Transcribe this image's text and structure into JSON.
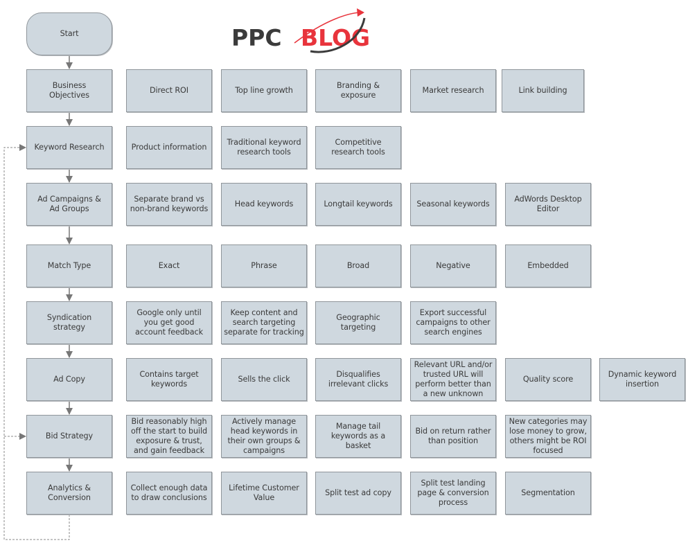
{
  "logo": {
    "text_dark": "PPC",
    "text_red": "BLOG",
    "colors": {
      "dark": "#3b3b3b",
      "red": "#e8343c"
    }
  },
  "colors": {
    "box_fill": "#cfd8df",
    "box_border": "#8f959a",
    "connector": "#777777"
  },
  "start": {
    "label": "Start"
  },
  "rows": [
    {
      "label": "Business\nObjectives",
      "items": [
        "Direct ROI",
        "Top line growth",
        "Branding &\nexposure",
        "Market research",
        "Link building"
      ]
    },
    {
      "label": "Keyword Research",
      "items": [
        "Product information",
        "Traditional keyword\nresearch tools",
        "Competitive\nresearch tools"
      ]
    },
    {
      "label": "Ad Campaigns &\nAd Groups",
      "items": [
        "Separate brand vs\nnon-brand keywords",
        "Head keywords",
        "Longtail keywords",
        "Seasonal keywords",
        "AdWords Desktop\nEditor"
      ]
    },
    {
      "label": "Match Type",
      "items": [
        "Exact",
        "Phrase",
        "Broad",
        "Negative",
        "Embedded"
      ]
    },
    {
      "label": "Syndication\nstrategy",
      "items": [
        "Google only until\nyou get good\naccount feedback",
        "Keep content and\nsearch targeting\nseparate for tracking",
        "Geographic\ntargeting",
        "Export successful\ncampaigns to other\nsearch engines"
      ]
    },
    {
      "label": "Ad Copy",
      "items": [
        "Contains target\nkeywords",
        "Sells the click",
        "Disqualifies\nirrelevant clicks",
        "Relevant URL and/or\ntrusted URL will\nperform better than\na new unknown",
        "Quality score",
        "Dynamic keyword\ninsertion"
      ]
    },
    {
      "label": "Bid Strategy",
      "items": [
        "Bid reasonably high\noff the start to build\nexposure & trust,\nand gain feedback",
        "Actively manage\nhead keywords in\ntheir own groups &\ncampaigns",
        "Manage tail\nkeywords as a\nbasket",
        "Bid on return rather\nthan position",
        "New categories may\nlose money to grow,\nothers might be ROI\nfocused"
      ]
    },
    {
      "label": "Analytics &\nConversion",
      "items": [
        "Collect enough data\nto draw conclusions",
        "Lifetime Customer\nValue",
        "Split test ad copy",
        "Split test landing\npage & conversion\nprocess",
        "Segmentation"
      ]
    }
  ]
}
